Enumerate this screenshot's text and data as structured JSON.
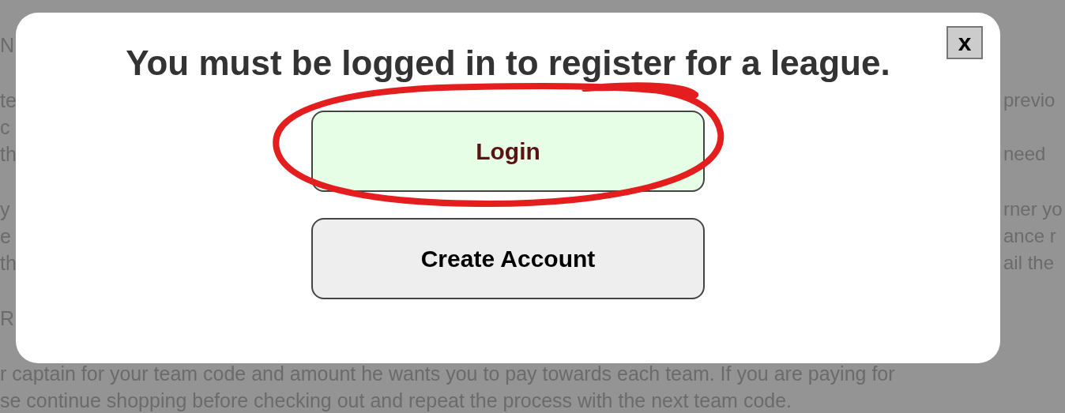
{
  "background": {
    "paragraphs": [
      {
        "lines": [
          {
            "left": "N"
          }
        ]
      },
      {
        "lines": [
          {
            "left": "te",
            "right": "previo"
          },
          {
            "left": "c"
          },
          {
            "left": "th",
            "right": "need"
          }
        ]
      },
      {
        "lines": [
          {
            "left": "y",
            "right": "rner yo"
          },
          {
            "left": "e",
            "right": "ance r"
          },
          {
            "left": "th",
            "right": "ail the"
          }
        ]
      },
      {
        "lines": [
          {
            "left": "R"
          }
        ]
      },
      {
        "lines": [
          {
            "left": "r captain for your team code and amount he wants you to pay towards each team. If you are paying for"
          },
          {
            "left": "se continue shopping before checking out and repeat the process with the next team code."
          }
        ]
      }
    ]
  },
  "dialog": {
    "title": "You must be logged in to register for a league.",
    "close": "x",
    "buttons": [
      {
        "label": "Login",
        "kind": "primary"
      },
      {
        "label": "Create Account",
        "kind": "secondary"
      }
    ]
  },
  "annotation": {
    "kind": "circle"
  }
}
